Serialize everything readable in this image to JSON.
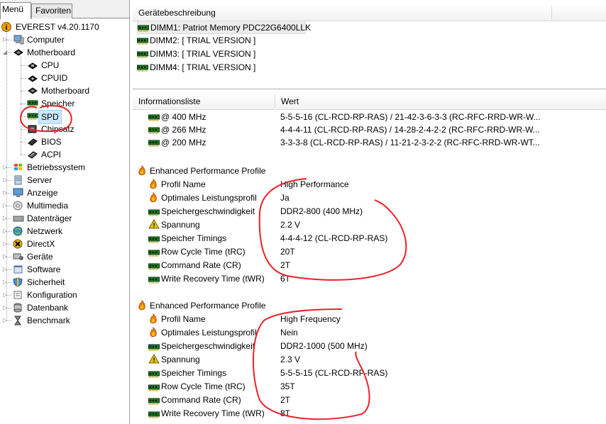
{
  "tabs": [
    "Menü",
    "Favoriten"
  ],
  "tree": {
    "root": "EVEREST v4.20.1170",
    "items": [
      {
        "label": "Computer",
        "icon": "computer-icon"
      },
      {
        "label": "Motherboard",
        "icon": "motherboard-icon",
        "expanded": true,
        "children": [
          {
            "label": "CPU",
            "icon": "cpu-icon"
          },
          {
            "label": "CPUID",
            "icon": "cpuid-icon"
          },
          {
            "label": "Motherboard",
            "icon": "motherboard-icon"
          },
          {
            "label": "Speicher",
            "icon": "memory-icon"
          },
          {
            "label": "SPD",
            "icon": "memory-icon",
            "selected": true
          },
          {
            "label": "Chipsatz",
            "icon": "chipset-icon"
          },
          {
            "label": "BIOS",
            "icon": "bios-icon"
          },
          {
            "label": "ACPI",
            "icon": "acpi-icon"
          }
        ]
      },
      {
        "label": "Betriebssystem",
        "icon": "windows-icon"
      },
      {
        "label": "Server",
        "icon": "server-icon"
      },
      {
        "label": "Anzeige",
        "icon": "monitor-icon"
      },
      {
        "label": "Multimedia",
        "icon": "multimedia-icon"
      },
      {
        "label": "Datenträger",
        "icon": "disk-icon"
      },
      {
        "label": "Netzwerk",
        "icon": "network-icon"
      },
      {
        "label": "DirectX",
        "icon": "directx-icon"
      },
      {
        "label": "Geräte",
        "icon": "devices-icon"
      },
      {
        "label": "Software",
        "icon": "software-icon"
      },
      {
        "label": "Sicherheit",
        "icon": "security-icon"
      },
      {
        "label": "Konfiguration",
        "icon": "config-icon"
      },
      {
        "label": "Datenbank",
        "icon": "database-icon"
      },
      {
        "label": "Benchmark",
        "icon": "benchmark-icon"
      }
    ]
  },
  "device": {
    "header": "Gerätebeschreibung",
    "items": [
      "DIMM1: Patriot Memory PDC22G6400LLK",
      "DIMM2: [ TRIAL VERSION ]",
      "DIMM3: [ TRIAL VERSION ]",
      "DIMM4: [ TRIAL VERSION ]"
    ]
  },
  "info": {
    "col_name": "Informationsliste",
    "col_value": "Wert",
    "timings": [
      {
        "name": "@ 400 MHz",
        "value": "5-5-5-16  (CL-RCD-RP-RAS) / 21-42-3-6-3-3  (RC-RFC-RRD-WR-W..."
      },
      {
        "name": "@ 266 MHz",
        "value": "4-4-4-11  (CL-RCD-RP-RAS) / 14-28-2-4-2-2  (RC-RFC-RRD-WR-W..."
      },
      {
        "name": "@ 200 MHz",
        "value": "3-3-3-8  (CL-RCD-RP-RAS) / 11-21-2-3-2-2  (RC-RFC-RRD-WR-WT..."
      }
    ],
    "profiles": [
      {
        "title": "Enhanced Performance Profile",
        "rows": [
          {
            "icon": "flame",
            "name": "Profil Name",
            "value": "High Performance"
          },
          {
            "icon": "flame",
            "name": "Optimales Leistungsprofil",
            "value": "Ja"
          },
          {
            "icon": "ram",
            "name": "Speichergeschwindigkeit",
            "value": "DDR2-800 (400 MHz)"
          },
          {
            "icon": "warn",
            "name": "Spannung",
            "value": "2.2 V"
          },
          {
            "icon": "ram",
            "name": "Speicher Timings",
            "value": "4-4-4-12  (CL-RCD-RP-RAS)"
          },
          {
            "icon": "ram",
            "name": "Row Cycle Time (tRC)",
            "value": "20T"
          },
          {
            "icon": "ram",
            "name": "Command Rate (CR)",
            "value": "2T"
          },
          {
            "icon": "ram",
            "name": "Write Recovery Time (tWR)",
            "value": "6T"
          }
        ]
      },
      {
        "title": "Enhanced Performance Profile",
        "rows": [
          {
            "icon": "flame",
            "name": "Profil Name",
            "value": "High Frequency"
          },
          {
            "icon": "flame",
            "name": "Optimales Leistungsprofil",
            "value": "Nein"
          },
          {
            "icon": "ram",
            "name": "Speichergeschwindigkeit",
            "value": "DDR2-1000 (500 MHz)"
          },
          {
            "icon": "warn",
            "name": "Spannung",
            "value": "2.3 V"
          },
          {
            "icon": "ram",
            "name": "Speicher Timings",
            "value": "5-5-5-15  (CL-RCD-RP-RAS)"
          },
          {
            "icon": "ram",
            "name": "Row Cycle Time (tRC)",
            "value": "35T"
          },
          {
            "icon": "ram",
            "name": "Command Rate (CR)",
            "value": "2T"
          },
          {
            "icon": "ram",
            "name": "Write Recovery Time (tWR)",
            "value": "8T"
          }
        ]
      }
    ]
  },
  "colors": {
    "annotation": "#e8222a",
    "ram": "#1c7a22",
    "selection": "#cce8ff"
  }
}
